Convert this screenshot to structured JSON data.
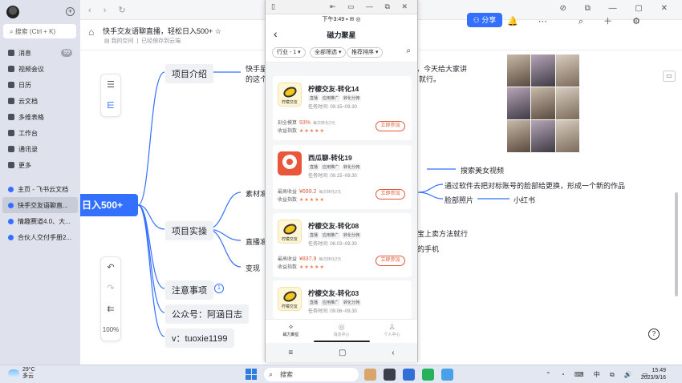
{
  "sidebar": {
    "search_placeholder": "搜索 (Ctrl + K)",
    "nav": [
      {
        "label": "消息",
        "badge": "99"
      },
      {
        "label": "视频会议"
      },
      {
        "label": "日历"
      },
      {
        "label": "云文档"
      },
      {
        "label": "多维表格"
      },
      {
        "label": "工作台"
      },
      {
        "label": "通讯录"
      },
      {
        "label": "更多"
      }
    ],
    "docs": [
      {
        "label": "主页 - 飞书云文档"
      },
      {
        "label": "快手交友语聊直..."
      },
      {
        "label": "情趣赛道4.0、大..."
      },
      {
        "label": "合伙人交付手册2..."
      }
    ]
  },
  "doc": {
    "title": "快手交友语聊直播，轻松日入500+",
    "location": "我的空间",
    "saved": "已经保存到云端",
    "share_label": "分享"
  },
  "mindmap": {
    "root": "日入500+",
    "branches": [
      "项目介绍",
      "项目实操",
      "注意事项",
      "公众号：阿涵日志",
      "v：tuoxie1199"
    ],
    "badge": "1",
    "texts": {
      "intro_a": "快手星",
      "intro_b": "的这个",
      "intro_c": "，今天给大家讲",
      "intro_d": "就行。",
      "sub1": "素材准",
      "sub2": "直播准",
      "sub3": "变现",
      "search_video": "搜索美女视频",
      "software": "通过软件去把对标账号的脸部给更换，形成一个新的作品",
      "face_photo": "脸部照片",
      "xiaohongshu": "小红书",
      "method": "宝上卖方法就行",
      "phone": "的手机"
    },
    "zoom": "100%"
  },
  "phone": {
    "status_time": "下午3:49",
    "app_title": "磁力聚星",
    "filters": [
      "行业 - 1",
      "全部筛选",
      "推荐排序"
    ],
    "cards": [
      {
        "title": "柠檬交友-转化14",
        "tags": [
          "直播",
          "应用推广",
          "转化分佣"
        ],
        "time": "任务时间: 09.15~09.30",
        "metric_label": "刻全模算",
        "metric_value": "93%",
        "metric_note": "每次转化2元",
        "score_label": "收益指数",
        "stars": "★★★★★",
        "button": "立即参加",
        "logo_text": "柠檬交友",
        "logo_type": "lemon"
      },
      {
        "title": "西瓜聊-转化19",
        "tags": [
          "直播",
          "应用推广",
          "转化分佣"
        ],
        "time": "任务时间: 09.15~09.30",
        "metric_label": "最高收益",
        "metric_value": "¥699.2",
        "metric_note": "每次转化2元",
        "score_label": "收益指数",
        "stars": "★★★★★",
        "button": "立即参加",
        "logo_text": "",
        "logo_type": "watermelon"
      },
      {
        "title": "柠檬交友-转化08",
        "tags": [
          "直播",
          "应用推广",
          "转化分佣"
        ],
        "time": "任务时间: 08.03~09.30",
        "metric_label": "最高收益",
        "metric_value": "¥837.9",
        "metric_note": "每次转化2元",
        "score_label": "收益指数",
        "stars": "★★★★★",
        "button": "立即参加",
        "logo_text": "柠檬交友",
        "logo_type": "lemon"
      },
      {
        "title": "柠檬交友-转化03",
        "tags": [
          "直播",
          "应用推广",
          "转化分佣"
        ],
        "time": "任务时间: 09.06~09.30",
        "logo_text": "柠檬交友",
        "logo_type": "lemon"
      }
    ],
    "bottom_tabs": [
      "磁力聚星",
      "消息中心",
      "个人中心"
    ]
  },
  "taskbar": {
    "temp": "29°C",
    "weather": "多云",
    "search": "搜索",
    "time": "15:49",
    "date": "2023/9/16",
    "ime": "中"
  }
}
